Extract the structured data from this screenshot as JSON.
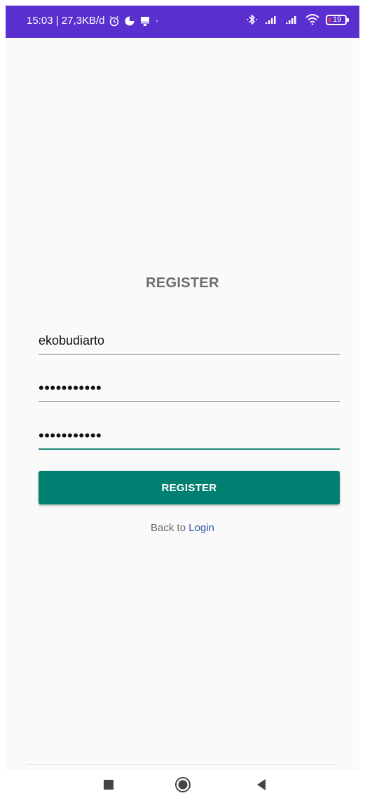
{
  "status_bar": {
    "left_text": "15:03 | 27,3KB/d",
    "dot": "·",
    "battery_level": "19",
    "icons": [
      "alarm-icon",
      "data-saver-icon",
      "usb-icon",
      "bluetooth-icon",
      "signal-icon",
      "signal-icon",
      "wifi-icon",
      "battery-icon"
    ],
    "background": "#5a2fd0"
  },
  "register": {
    "title": "REGISTER",
    "username_value": "ekobudiarto",
    "password_mask": "•••••••••••",
    "confirm_password_mask": "•••••••••••",
    "button_label": "REGISTER",
    "back_text": "Back to",
    "login_link": "Login"
  },
  "colors": {
    "accent": "#1f8a78",
    "button": "#017f70",
    "link": "#2c5aa0"
  },
  "nav_bar": {
    "icons": [
      "recents-square-icon",
      "home-circle-icon",
      "back-triangle-icon"
    ]
  }
}
